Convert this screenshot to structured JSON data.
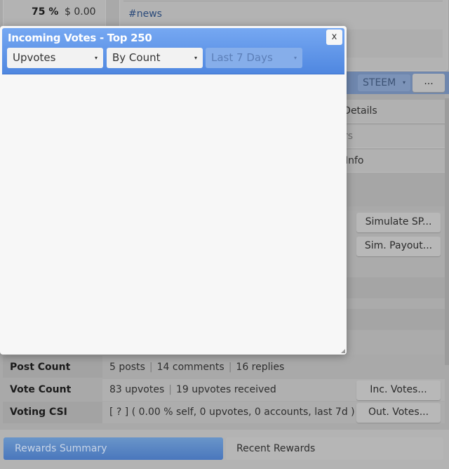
{
  "background": {
    "percent": "75 %",
    "amount": "$ 0.00",
    "tag": "#news",
    "currency_select": "STEEM",
    "more_button": "...",
    "partial_rows": [
      ": Details",
      "rs",
      "Info"
    ],
    "simulate_sp": "Simulate SP...",
    "sim_payout": "Sim. Payout...",
    "stats": [
      {
        "label": "Post Count",
        "parts": [
          "5 posts",
          "14 comments",
          "16 replies"
        ]
      },
      {
        "label": "Vote Count",
        "parts": [
          "83 upvotes",
          "19 upvotes received"
        ],
        "button": "Inc. Votes..."
      },
      {
        "label": "Voting CSI",
        "parts": [
          "[ ? ] ( 0.00 % self, 0 upvotes, 0 accounts, last 7d )"
        ],
        "button": "Out. Votes..."
      }
    ],
    "tabs": [
      {
        "label": "Rewards Summary",
        "active": true
      },
      {
        "label": "Recent Rewards",
        "active": false
      }
    ]
  },
  "modal": {
    "title": "Incoming Votes - Top 250",
    "close": "x",
    "filters": [
      {
        "value": "Upvotes"
      },
      {
        "value": "By Count"
      },
      {
        "value": "Last 7 Days",
        "disabled": true
      }
    ],
    "arrow": "▾"
  },
  "colors": {
    "accent": "#4f87e0",
    "overlay": "#a9a9a9"
  }
}
